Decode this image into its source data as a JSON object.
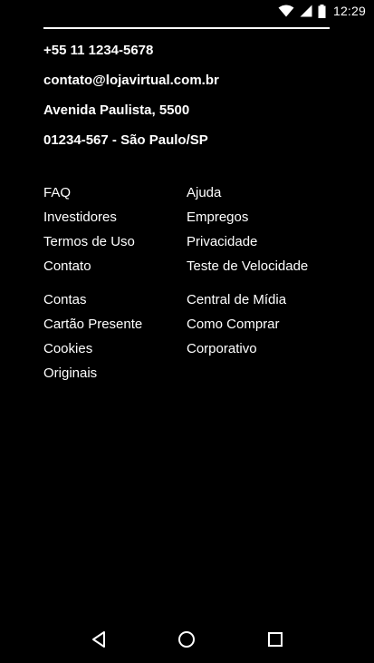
{
  "status_bar": {
    "time": "12:29",
    "icons": [
      "wifi-icon",
      "cell-signal-icon",
      "battery-icon"
    ]
  },
  "footer": {
    "contact": {
      "phone": "+55 11 1234-5678",
      "email": "contato@lojavirtual.com.br",
      "address": "Avenida Paulista, 5500",
      "zip_city": "01234-567 - São Paulo/SP"
    },
    "links_group_1": {
      "left": [
        "FAQ",
        "Investidores",
        "Termos de Uso",
        "Contato"
      ],
      "right": [
        "Ajuda",
        "Empregos",
        "Privacidade",
        "Teste de Velocidade"
      ]
    },
    "links_group_2": {
      "left": [
        "Contas",
        "Cartão Presente",
        "Cookies",
        "Originais"
      ],
      "right": [
        "Central de Mídia",
        "Como Comprar",
        "Corporativo"
      ]
    }
  },
  "nav_bar": {
    "icons": [
      "back-icon",
      "home-icon",
      "recents-icon"
    ]
  }
}
